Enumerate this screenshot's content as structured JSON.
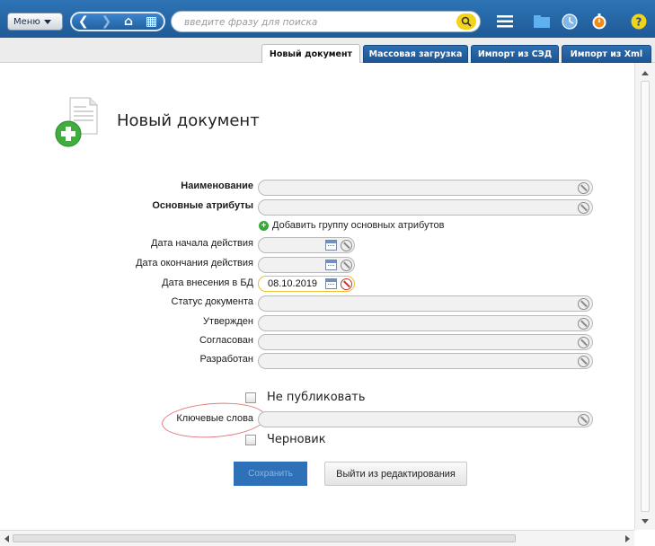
{
  "toolbar": {
    "menu_label": "Меню",
    "search_placeholder": "введите фразу для поиска"
  },
  "tabs": [
    {
      "label": "Новый документ",
      "active": true
    },
    {
      "label": "Массовая загрузка",
      "active": false
    },
    {
      "label": "Импорт из СЭД",
      "active": false
    },
    {
      "label": "Импорт из Xml",
      "active": false
    }
  ],
  "page": {
    "title": "Новый документ"
  },
  "form": {
    "name_label": "Наименование",
    "main_attrs_label": "Основные атрибуты",
    "add_group_label": "Добавить группу основных атрибутов",
    "start_date_label": "Дата начала действия",
    "end_date_label": "Дата окончания действия",
    "db_date_label": "Дата внесения в БД",
    "db_date_value": "08.10.2019",
    "status_label": "Статус документа",
    "approved_label": "Утвержден",
    "agreed_label": "Согласован",
    "developed_label": "Разработан",
    "no_publish_label": "Не публиковать",
    "keywords_label": "Ключевые слова",
    "draft_label": "Черновик"
  },
  "actions": {
    "save_label": "Сохранить",
    "exit_label": "Выйти из редактирования"
  },
  "colors": {
    "toolbar_blue": "#2e74b5",
    "accent_yellow": "#f3d31a",
    "save_button": "#2f71b8",
    "highlight_oval": "#e07a7a"
  }
}
